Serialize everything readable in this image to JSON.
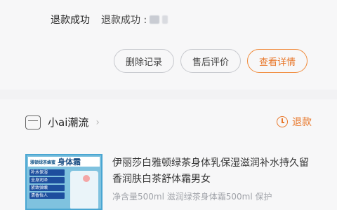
{
  "order": {
    "status": "退款成功",
    "status_detail": "退款成功 :",
    "buttons": {
      "delete": "删除记录",
      "review": "售后评价",
      "details": "查看详情"
    }
  },
  "shop": {
    "name": "小ai潮流",
    "refund_tag": "退款"
  },
  "product": {
    "title": "伊丽莎白雅顿绿茶身体乳保湿滋润补水持久留香润肤白茶舒体霜男女",
    "spec": "净含量500ml 滋润绿茶身体霜500ml 保护",
    "thumb": {
      "brand": "雅顿绿茶蜂蜜",
      "headline": "身体霜",
      "features": [
        "补水保湿",
        "全身润泽",
        "紧致弹嫩",
        "清香怡人"
      ]
    }
  },
  "colors": {
    "accent": "#e8772a",
    "background": "#f2f2f4"
  },
  "icons": [
    "shop-icon",
    "chevron-right-icon",
    "clock-icon"
  ]
}
